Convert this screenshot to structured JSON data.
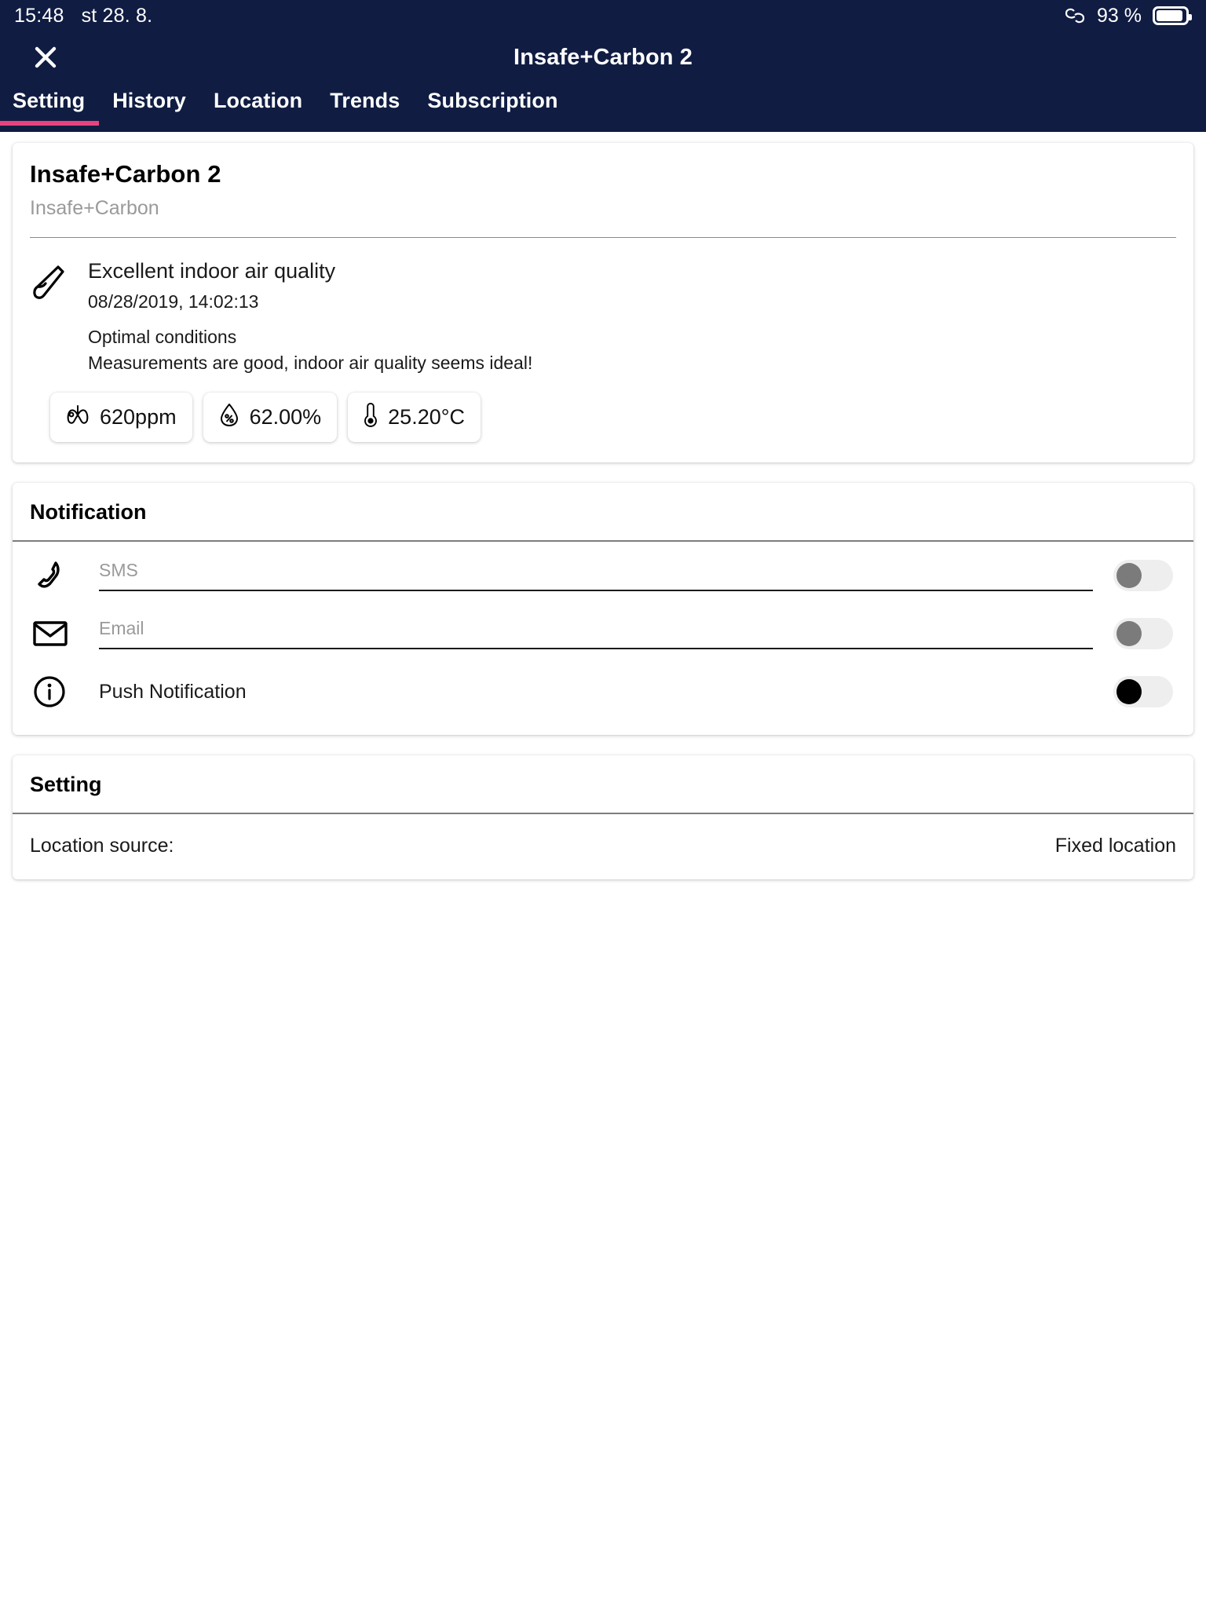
{
  "status_bar": {
    "time": "15:48",
    "date": "st 28. 8.",
    "battery_percent": "93 %",
    "battery_level": 93,
    "left_icon": "link-icon"
  },
  "navbar": {
    "close_icon": "close-icon",
    "title": "Insafe+Carbon 2"
  },
  "tabs": [
    {
      "label": "Setting",
      "active": true
    },
    {
      "label": "History",
      "active": false
    },
    {
      "label": "Location",
      "active": false
    },
    {
      "label": "Trends",
      "active": false
    },
    {
      "label": "Subscription",
      "active": false
    }
  ],
  "colors": {
    "header_bg": "#101c42",
    "accent": "#e8437f",
    "page_bg": "#ffffff",
    "card_bg": "#ffffff",
    "muted_text": "#9a9a9a"
  },
  "device_card": {
    "title": "Insafe+Carbon 2",
    "subtitle": "Insafe+Carbon",
    "air_quality": {
      "icon": "test-tube-icon",
      "headline": "Excellent indoor air quality",
      "timestamp": "08/28/2019, 14:02:13",
      "status": "Optimal conditions",
      "description": "Measurements are good, indoor air quality seems ideal!"
    },
    "measurements": [
      {
        "icon": "lungs-icon",
        "value": "620ppm"
      },
      {
        "icon": "humidity-drop-icon",
        "value": "62.00%"
      },
      {
        "icon": "thermometer-icon",
        "value": "25.20°C"
      }
    ]
  },
  "notification_card": {
    "header": "Notification",
    "rows": [
      {
        "icon": "phone-icon",
        "type": "input",
        "placeholder": "SMS",
        "value": "",
        "toggle_enabled": false,
        "toggle_on": false
      },
      {
        "icon": "envelope-icon",
        "type": "input",
        "placeholder": "Email",
        "value": "",
        "toggle_enabled": false,
        "toggle_on": false
      },
      {
        "icon": "info-icon",
        "type": "label",
        "label": "Push Notification",
        "toggle_enabled": true,
        "toggle_on": false
      }
    ]
  },
  "setting_card": {
    "header": "Setting",
    "rows": [
      {
        "label": "Location source:",
        "value": "Fixed location"
      }
    ]
  }
}
